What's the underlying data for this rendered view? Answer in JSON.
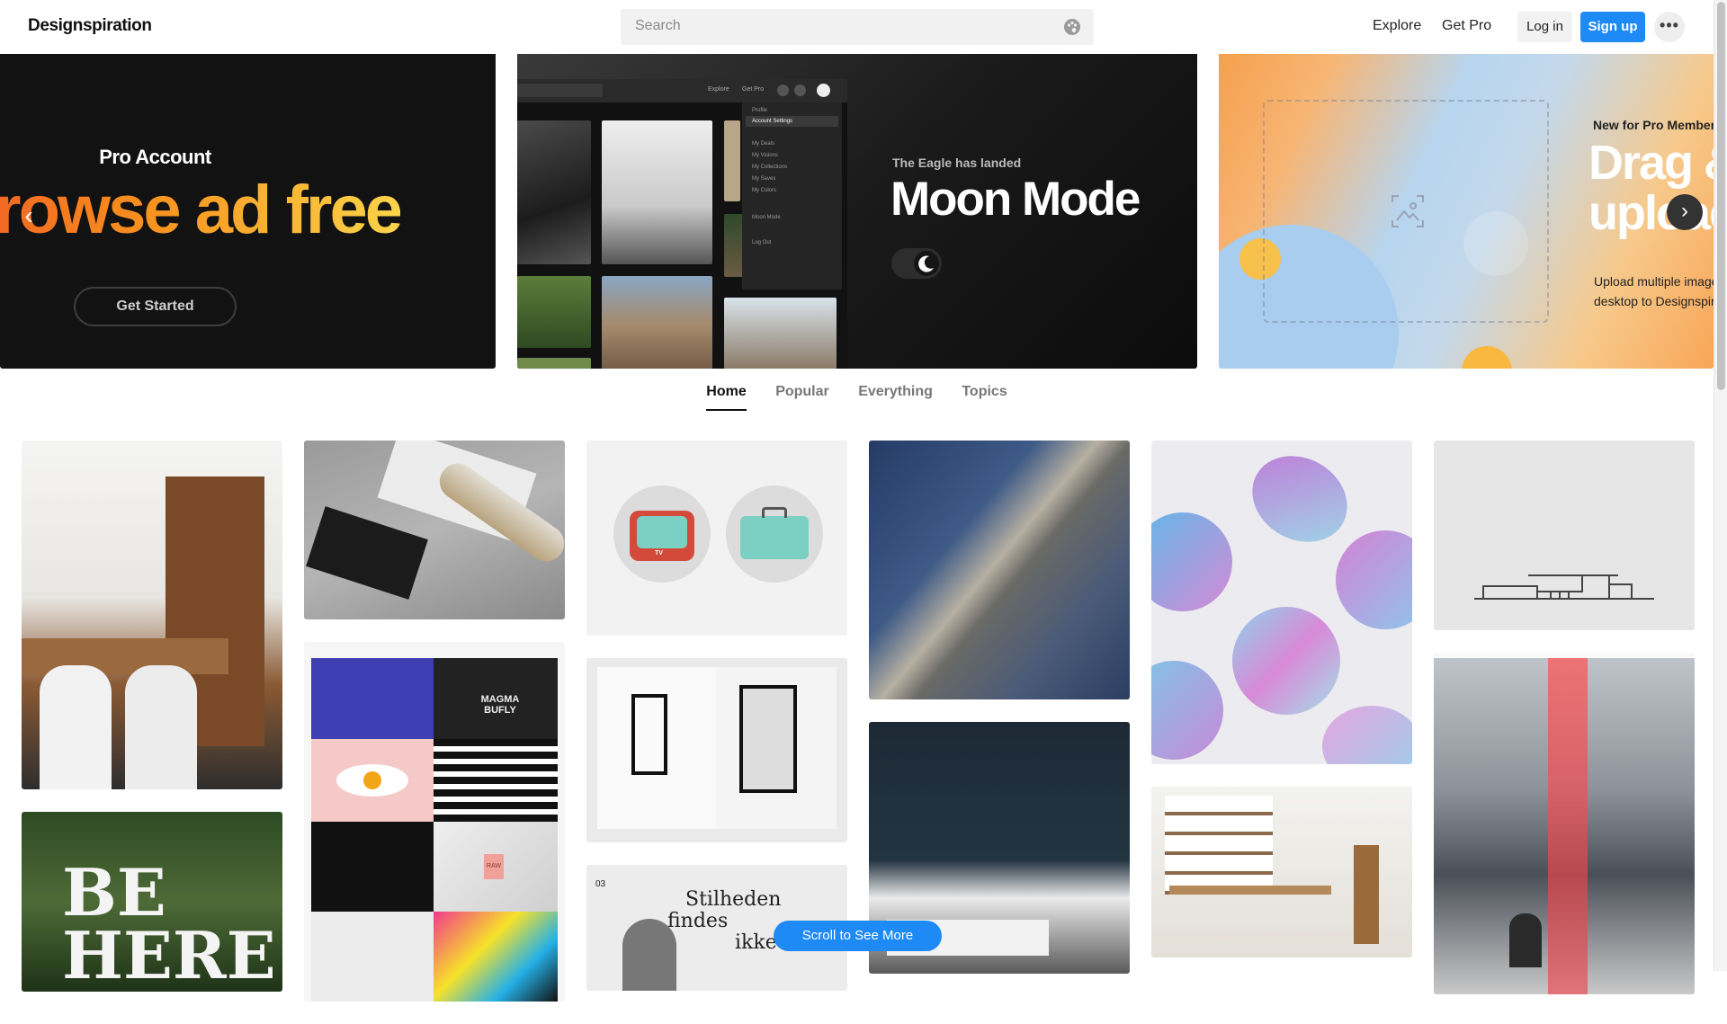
{
  "header": {
    "logo": "Designspiration",
    "search_placeholder": "Search",
    "nav": {
      "explore": "Explore",
      "get_pro": "Get Pro"
    },
    "login": "Log in",
    "signup": "Sign up",
    "more": "•••"
  },
  "carousel": {
    "slide1": {
      "title": "Pro Account",
      "headline": "Browse ad free",
      "button": "Get Started"
    },
    "slide2": {
      "kicker": "The Eagle has landed",
      "title": "Moon Mode",
      "mock": {
        "links": [
          "Explore",
          "Get Pro"
        ],
        "menu": [
          "Profile",
          "Account Settings",
          "My Deals",
          "My Visions",
          "My Collections",
          "My Saves",
          "My Colors",
          "Moon Mode",
          "Log Out"
        ]
      }
    },
    "slide3": {
      "kicker": "New for Pro Members",
      "title_line1": "Drag &",
      "title_line2": "upload",
      "desc_line1": "Upload multiple images from your",
      "desc_line2": "desktop to Designspiration"
    },
    "prev": "‹",
    "next": "›"
  },
  "tabs": [
    "Home",
    "Popular",
    "Everything",
    "Topics"
  ],
  "active_tab": "Home",
  "grid": {
    "col2_texts": {
      "magma": "MAGMA BUFLY",
      "raw": "RAW"
    },
    "col3_texts": {
      "tv": "TV",
      "magazine_num": "03",
      "magazine_title1": "Stilheden",
      "magazine_title2": "findes",
      "magazine_title3": "ikke"
    },
    "col1_texts": {
      "be_here": "BE HERE"
    }
  },
  "scroll_button": "Scroll to See More",
  "colors": {
    "accent": "#1e8af5",
    "pro_gradient_start": "#f15a24",
    "pro_gradient_end": "#fbd44a"
  }
}
